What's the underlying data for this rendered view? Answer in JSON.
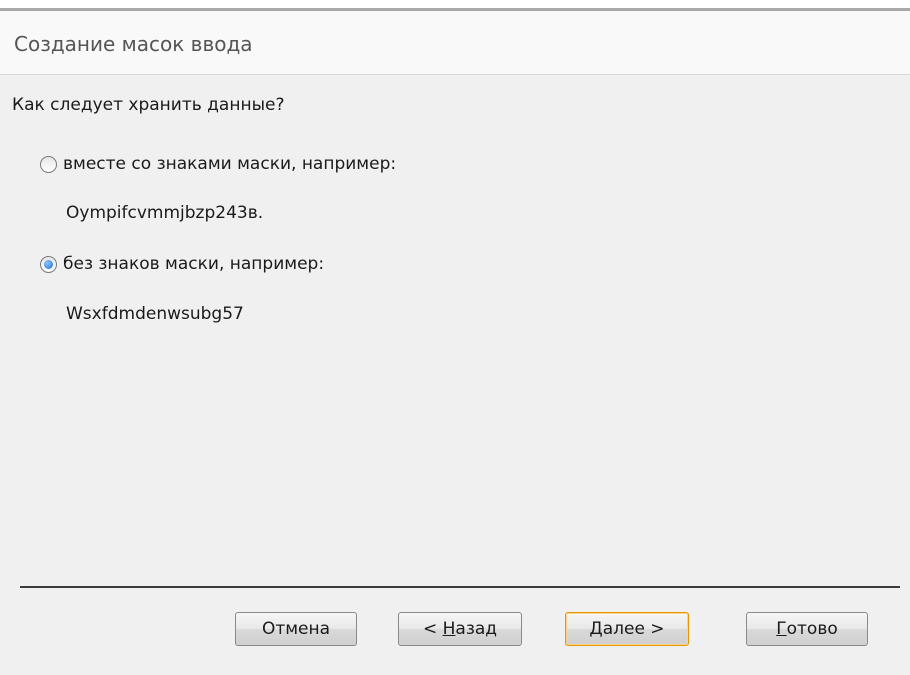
{
  "dialog": {
    "title": "Создание масок ввода",
    "question": "Как следует хранить данные?"
  },
  "options": [
    {
      "label": "вместе со знаками маски, например:",
      "example": "Oympifcvmmjbzp243в.",
      "selected": false
    },
    {
      "label": "без знаков маски, например:",
      "example": "Wsxfdmdenwsubg57",
      "selected": true
    }
  ],
  "buttons": {
    "cancel": {
      "label": "Отмена"
    },
    "back": {
      "prefix": "< ",
      "mnemonic": "Н",
      "rest": "азад"
    },
    "next": {
      "mnemonic": "Д",
      "rest": "алее >"
    },
    "finish": {
      "mnemonic": "Г",
      "rest": "отово"
    }
  },
  "colors": {
    "background": "#f0f0f0",
    "title_bar": "#f9f9f9",
    "default_button_border": "#e59700",
    "radio_selected": "#1a6fd6"
  }
}
